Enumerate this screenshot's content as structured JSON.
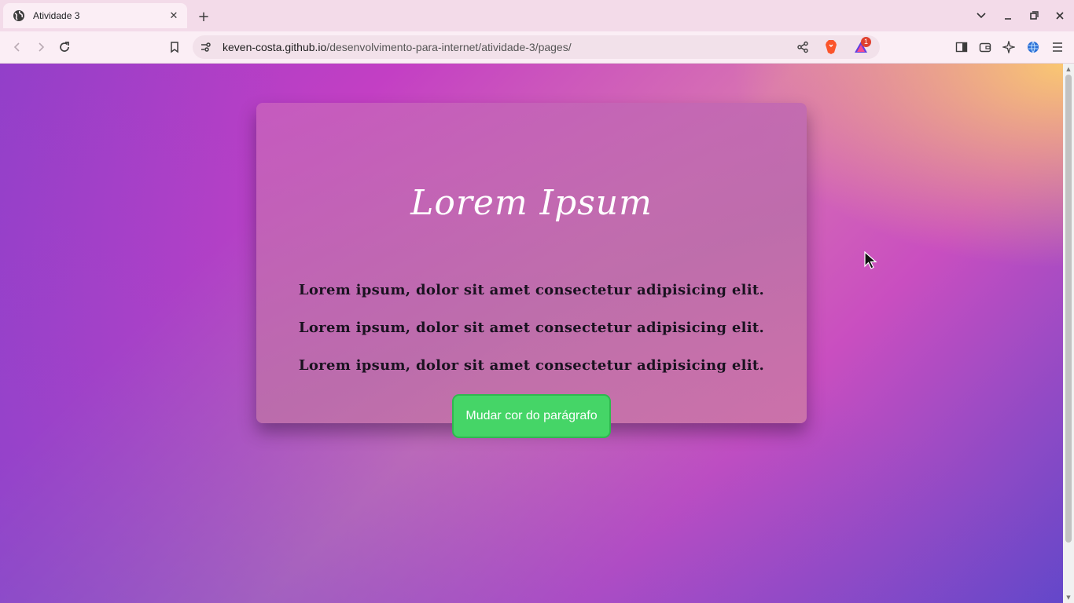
{
  "tab": {
    "title": "Atividade 3"
  },
  "address_bar": {
    "host": "keven-costa.github.io",
    "path": "/desenvolvimento-para-internet/atividade-3/pages/"
  },
  "extensions": {
    "brave_rewards_badge": "1"
  },
  "page": {
    "title": "Lorem Ipsum",
    "paragraphs": [
      "Lorem ipsum, dolor sit amet consectetur adipisicing elit.",
      "Lorem ipsum, dolor sit amet consectetur adipisicing elit.",
      "Lorem ipsum, dolor sit amet consectetur adipisicing elit."
    ],
    "button_label": "Mudar cor do parágrafo"
  },
  "colors": {
    "button": "#45d567",
    "title_text": "#ffffff",
    "paragraph_text": "#1a1220"
  }
}
